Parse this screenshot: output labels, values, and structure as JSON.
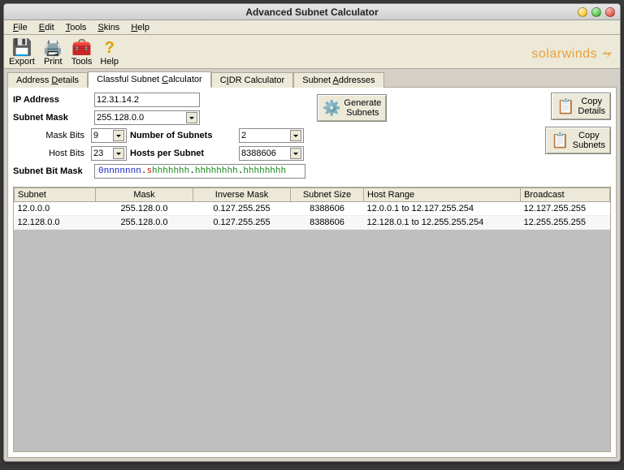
{
  "window": {
    "title": "Advanced Subnet Calculator"
  },
  "menus": [
    "File",
    "Edit",
    "Tools",
    "Skins",
    "Help"
  ],
  "toolbar": {
    "export": "Export",
    "print": "Print",
    "tools": "Tools",
    "help": "Help",
    "brand": "solarwinds"
  },
  "tabs": {
    "address_details": "Address Details",
    "classful": "Classful Subnet Calculator",
    "cidr": "CIDR Calculator",
    "subnet_addresses": "Subnet Addresses"
  },
  "form": {
    "ip_label": "IP Address",
    "ip_value": "12.31.14.2",
    "mask_label": "Subnet Mask",
    "mask_value": "255.128.0.0",
    "maskbits_label": "Mask Bits",
    "maskbits_value": "9",
    "hostbits_label": "Host Bits",
    "hostbits_value": "23",
    "numsubnets_label": "Number of Subnets",
    "numsubnets_value": "2",
    "hostspersubnet_label": "Hosts per Subnet",
    "hostspersubnet_value": "8388606",
    "bitmask_label": "Subnet Bit Mask",
    "bitmask_parts": {
      "z": "0",
      "n": "nnnnnnn",
      "d": ".",
      "s": "s",
      "h1": "hhhhhhh",
      "h2": "hhhhhhhh",
      "h3": "hhhhhhhh"
    }
  },
  "buttons": {
    "generate": "Generate\nSubnets",
    "copy_details": "Copy\nDetails",
    "copy_subnets": "Copy\nSubnets"
  },
  "table": {
    "headers": [
      "Subnet",
      "Mask",
      "Inverse Mask",
      "Subnet Size",
      "Host Range",
      "Broadcast"
    ],
    "rows": [
      {
        "subnet": "12.0.0.0",
        "mask": "255.128.0.0",
        "inverse": "0.127.255.255",
        "size": "8388606",
        "range": "12.0.0.1  to  12.127.255.254",
        "broadcast": "12.127.255.255"
      },
      {
        "subnet": "12.128.0.0",
        "mask": "255.128.0.0",
        "inverse": "0.127.255.255",
        "size": "8388606",
        "range": "12.128.0.1  to  12.255.255.254",
        "broadcast": "12.255.255.255"
      }
    ]
  }
}
